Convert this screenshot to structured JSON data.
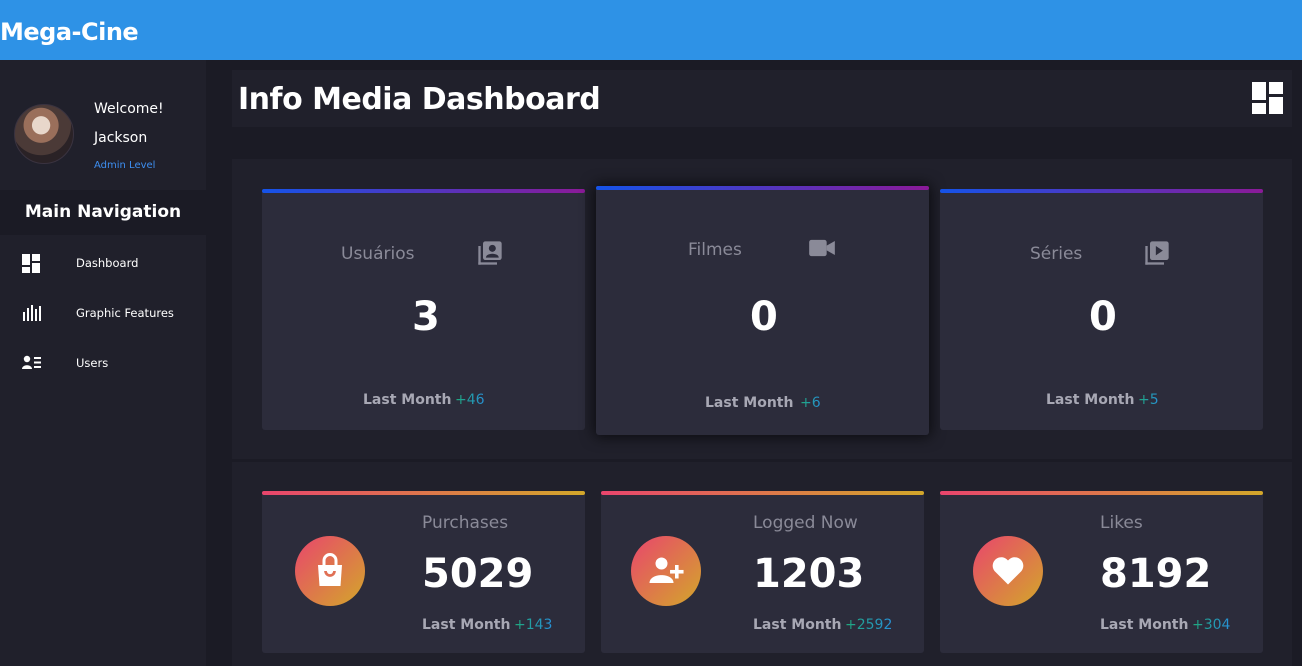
{
  "app": {
    "title": "Mega-Cine"
  },
  "profile": {
    "welcome": "Welcome!",
    "name": "Jackson",
    "level": "Admin Level"
  },
  "nav": {
    "heading": "Main Navigation",
    "items": [
      {
        "label": "Dashboard",
        "icon": "dashboard-icon"
      },
      {
        "label": "Graphic Features",
        "icon": "bar-chart-icon"
      },
      {
        "label": "Users",
        "icon": "users-icon"
      }
    ]
  },
  "header": {
    "title": "Info Media Dashboard",
    "icon": "dashboard-icon"
  },
  "stats_top": [
    {
      "label": "Usuários",
      "value": "3",
      "last_month_label": "Last Month",
      "last_month_value": "+46",
      "icon": "contacts-icon"
    },
    {
      "label": "Filmes",
      "value": "0",
      "last_month_label": "Last Month",
      "last_month_value": "+6",
      "icon": "video-camera-icon"
    },
    {
      "label": "Séries",
      "value": "0",
      "last_month_label": "Last Month",
      "last_month_value": "+5",
      "icon": "video-library-icon"
    }
  ],
  "stats_bottom": [
    {
      "label": "Purchases",
      "value": "5029",
      "last_month_label": "Last Month",
      "last_month_value": "+143",
      "icon": "shopping-bag-icon"
    },
    {
      "label": "Logged Now",
      "value": "1203",
      "last_month_label": "Last Month",
      "last_month_value": "+2592",
      "icon": "add-user-icon"
    },
    {
      "label": "Likes",
      "value": "8192",
      "last_month_label": "Last Month",
      "last_month_value": "+304",
      "icon": "heart-icon"
    }
  ],
  "colors": {
    "topbar": "#2e92e6",
    "background": "#1b1b25",
    "panel": "#20202b",
    "card": "#2c2c3b",
    "accent_blue_start": "#1553e8",
    "accent_purple_end": "#8b1a98",
    "accent_warm_start": "#e9456d",
    "accent_warm_end": "#d3a72a"
  }
}
